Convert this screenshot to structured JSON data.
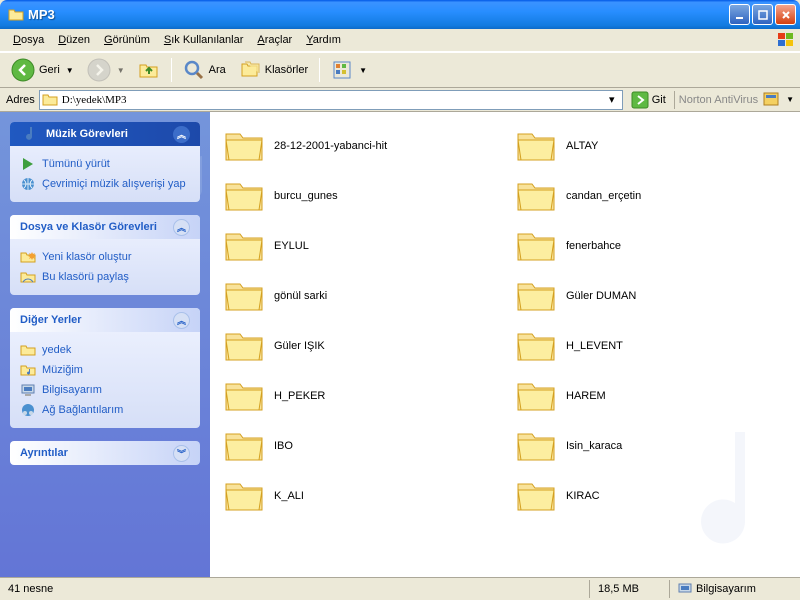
{
  "window": {
    "title": "MP3"
  },
  "menu": [
    "Dosya",
    "Düzen",
    "Görünüm",
    "Sık Kullanılanlar",
    "Araçlar",
    "Yardım"
  ],
  "toolbar": {
    "back": "Geri",
    "search": "Ara",
    "folders": "Klasörler"
  },
  "address": {
    "label": "Adres",
    "path": "D:\\yedek\\MP3",
    "go": "Git",
    "av": "Norton AntiVirus"
  },
  "panels": {
    "music": {
      "title": "Müzik Görevleri",
      "links": [
        "Tümünü yürüt",
        "Çevrimiçi müzik alışverişi yap"
      ]
    },
    "file": {
      "title": "Dosya ve Klasör Görevleri",
      "links": [
        "Yeni klasör oluştur",
        "Bu klasörü paylaş"
      ]
    },
    "places": {
      "title": "Diğer Yerler",
      "links": [
        "yedek",
        "Müziğim",
        "Bilgisayarım",
        "Ağ Bağlantılarım"
      ]
    },
    "details": {
      "title": "Ayrıntılar"
    }
  },
  "folders": [
    "28-12-2001-yabanci-hit",
    "ALTAY",
    "burcu_gunes",
    "candan_erçetin",
    "EYLUL",
    "fenerbahce",
    "gönül sarki",
    "Güler DUMAN",
    "Güler IŞIK",
    "H_LEVENT",
    "H_PEKER",
    "HAREM",
    "IBO",
    "Isin_karaca",
    "K_ALI",
    "KIRAC"
  ],
  "status": {
    "count": "41 nesne",
    "size": "18,5 MB",
    "loc": "Bilgisayarım"
  }
}
